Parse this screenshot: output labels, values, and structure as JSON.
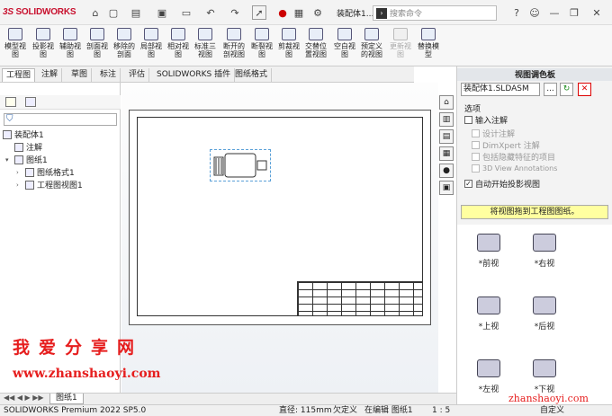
{
  "app": {
    "logo": "SOLIDWORKS",
    "doc_title": "装配体1...",
    "search_placeholder": "搜索命令"
  },
  "commands": [
    "模型视图",
    "投影视图",
    "辅助视图",
    "剖面视图",
    "移除的剖面",
    "局部视图",
    "相对视图",
    "标准三视图",
    "断开的剖视图",
    "断裂视图",
    "剪裁视图",
    "交替位置视图",
    "空白视图",
    "预定义的视图",
    "更新视图",
    "替换模型"
  ],
  "tabs": [
    "工程图",
    "注解",
    "草图",
    "标注",
    "评估",
    "SOLIDWORKS 插件",
    "图纸格式"
  ],
  "tree": {
    "root": "装配体1",
    "notes": "注解",
    "sheet": "图纸1",
    "format": "图纸格式1",
    "view": "工程图视图1"
  },
  "palette": {
    "title": "视图调色板",
    "file": "装配体1.SLDASM",
    "btn_browse": "...",
    "options_title": "选项",
    "opt_import": "输入注解",
    "opt_design": "设计注解",
    "opt_dimxpert": "DimXpert 注解",
    "opt_hidden": "包括隐藏特征的项目",
    "opt_3d": "3D View Annotations",
    "opt_auto": "自动开始投影视图",
    "drag_hint": "将视图拖到工程图图纸。",
    "views": [
      "*前视",
      "*右视",
      "*上视",
      "*后视",
      "*左视",
      "*下视"
    ]
  },
  "sheet_tab": "图纸1",
  "status": {
    "version": "SOLIDWORKS Premium 2022 SP5.0",
    "diameter": "直径: 115mm",
    "status_def": "欠定义",
    "editing": "在编辑 图纸1",
    "scale": "1 : 5",
    "custom": "自定义"
  },
  "watermark": {
    "line1": "我爱分享网",
    "line2": "www.zhanshaoyi.com",
    "line3": "zhanshaoyi.com"
  }
}
